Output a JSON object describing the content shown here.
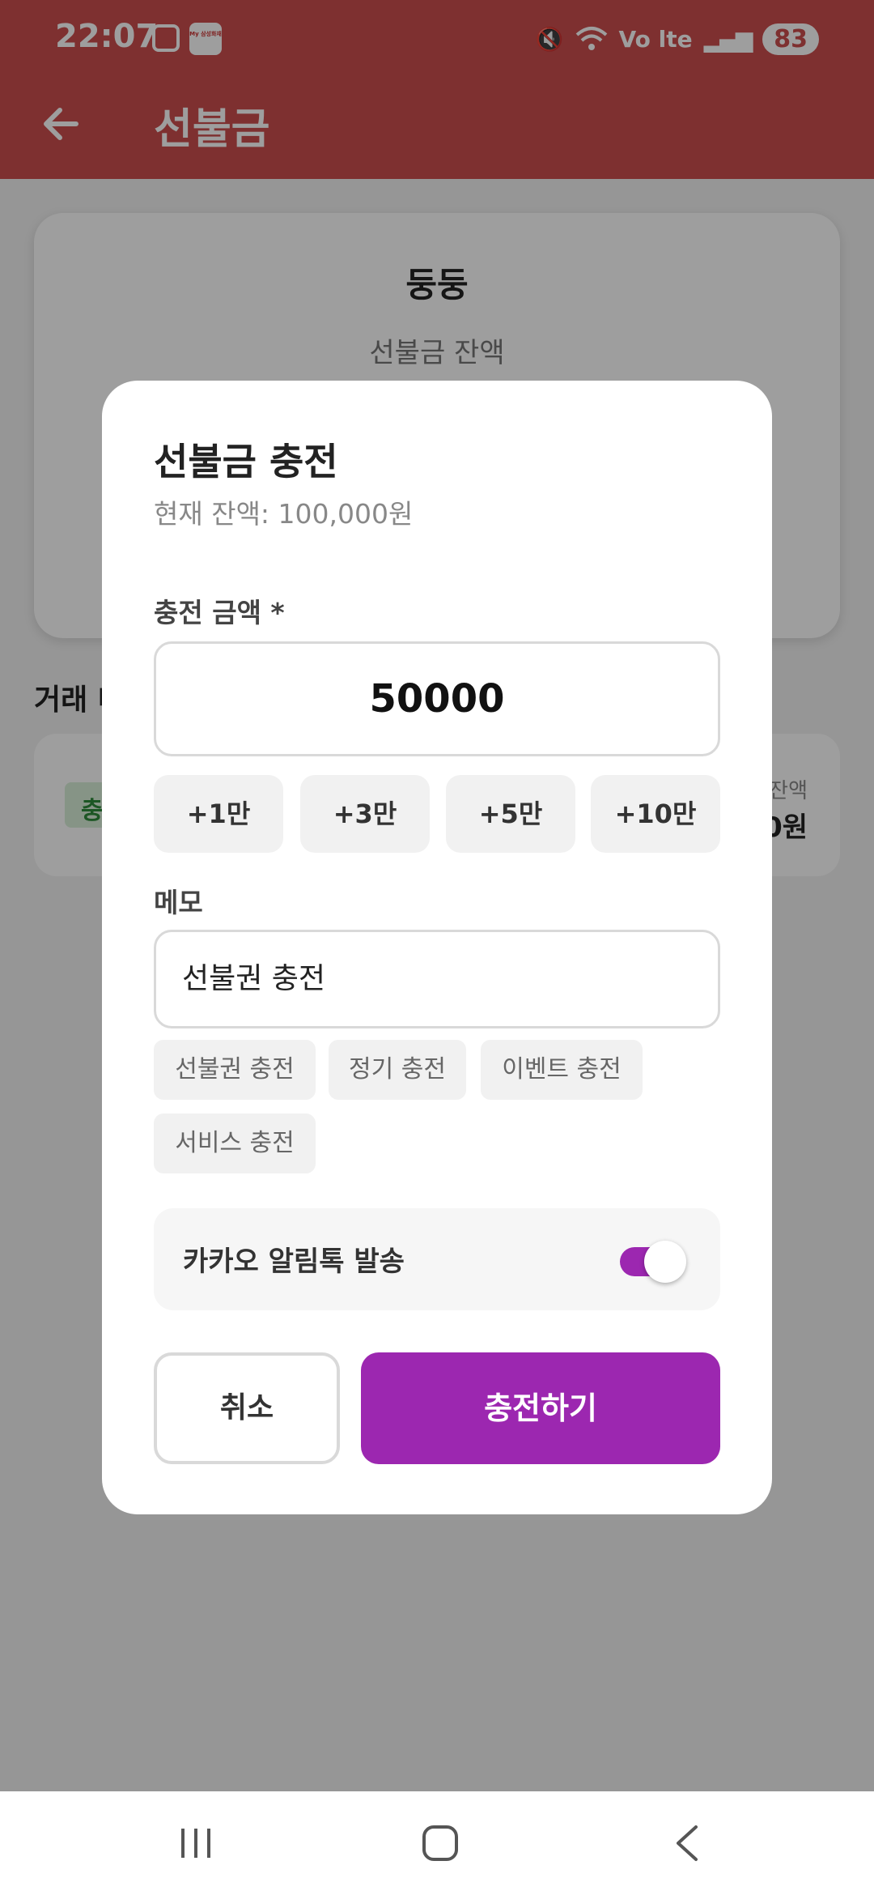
{
  "status_bar": {
    "time": "22:07",
    "my_app_label": "My 삼성화재",
    "network": "Vo lte",
    "battery": "83"
  },
  "app_bar": {
    "title": "선불금"
  },
  "background": {
    "card_name": "둥둥",
    "card_label": "선불금 잔액",
    "history_title": "거래 내",
    "history_badge": "충",
    "history_balance_label": "잔액",
    "history_balance_value": "0원"
  },
  "dialog": {
    "title": "선불금 충전",
    "subtitle": "현재 잔액: 100,000원",
    "amount_label": "충전 금액 *",
    "amount_value": "50000",
    "quick_amounts": [
      "+1만",
      "+3만",
      "+5만",
      "+10만"
    ],
    "memo_label": "메모",
    "memo_value": "선불권 충전",
    "memo_chips": [
      "선불권 충전",
      "정기 충전",
      "이벤트 충전",
      "서비스 충전"
    ],
    "kakao_label": "카카오 알림톡 발송",
    "kakao_enabled": true,
    "cancel_label": "취소",
    "submit_label": "충전하기"
  },
  "colors": {
    "app_bar": "#cc4e4e",
    "accent": "#9c27b0"
  }
}
